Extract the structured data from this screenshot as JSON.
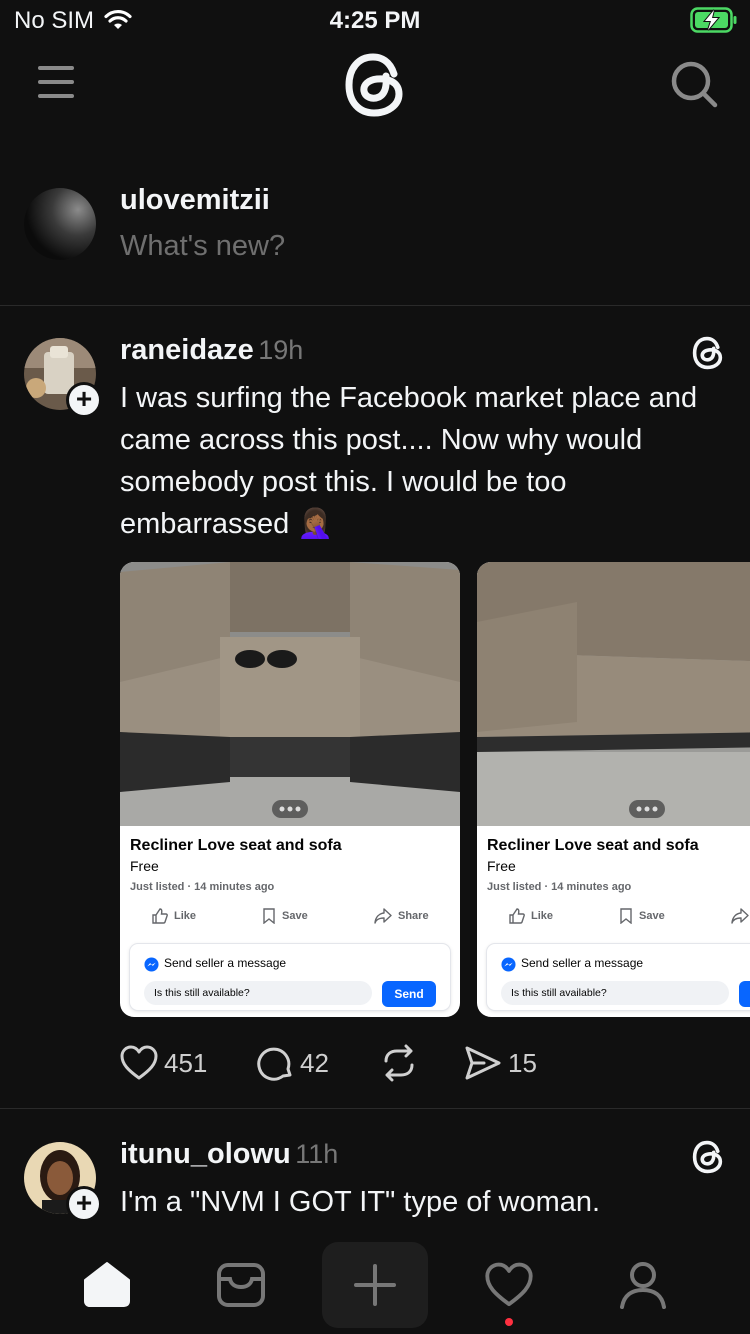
{
  "status_bar": {
    "carrier": "No SIM",
    "time": "4:25 PM"
  },
  "composer": {
    "username": "ulovemitzii",
    "placeholder": "What's new?"
  },
  "posts": [
    {
      "username": "raneidaze",
      "time": "19h",
      "text": "I was surfing the Facebook market place and came across this post.... Now why would somebody post this. I would be too embarrassed 🤦🏾‍♀️",
      "cards": [
        {
          "title": "Recliner Love seat and sofa",
          "price": "Free",
          "listed": "Just listed · 14 minutes ago",
          "like": "Like",
          "save": "Save",
          "share": "Share",
          "msg_title": "Send seller a message",
          "msg_input": "Is this still available?",
          "send": "Send"
        },
        {
          "title": "Recliner Love seat and sofa",
          "price": "Free",
          "listed": "Just listed · 14 minutes ago",
          "like": "Like",
          "save": "Save",
          "msg_title": "Send seller a message",
          "msg_input": "Is this still available?"
        }
      ],
      "stats": {
        "likes": "451",
        "replies": "42",
        "shares": "15"
      }
    },
    {
      "username": "itunu_olowu",
      "time": "11h",
      "text": "I'm a \"NVM I GOT IT\" type of woman."
    }
  ],
  "icons": [
    "menu-icon",
    "threads-logo-icon",
    "search-icon",
    "heart-icon",
    "comment-icon",
    "repost-icon",
    "send-icon",
    "home-icon",
    "inbox-icon",
    "plus-icon",
    "activity-icon",
    "profile-icon"
  ],
  "colors": {
    "background": "#101010",
    "notification_dot": "#ff3040",
    "fb_blue": "#0866ff",
    "battery_green": "#4cd964"
  }
}
